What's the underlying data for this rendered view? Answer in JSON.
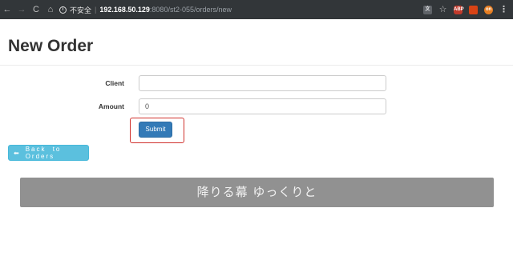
{
  "browser": {
    "back_glyph": "←",
    "forward_glyph": "→",
    "reload_glyph": "C",
    "home_glyph": "⌂",
    "info_glyph": "i",
    "security_text": "不安全",
    "separator": "|",
    "url_host": "192.168.50.129",
    "url_path": ":8080/st2-055/orders/new",
    "ext_abp": "ABP",
    "ext_orange": "on",
    "star_glyph": "☆",
    "menu_glyph": "⋮"
  },
  "page": {
    "title": "New Order"
  },
  "form": {
    "client_label": "Client",
    "client_value": "",
    "amount_label": "Amount",
    "amount_value": "0",
    "submit_label": "Submit"
  },
  "back_button": {
    "icon_glyph": "⬅",
    "label": "Back to Orders"
  },
  "banner": {
    "text": "降りる幕 ゆっくりと"
  },
  "colors": {
    "primary": "#337ab7",
    "info": "#5bc0de",
    "highlight": "#d0312d",
    "banner": "#919191"
  }
}
